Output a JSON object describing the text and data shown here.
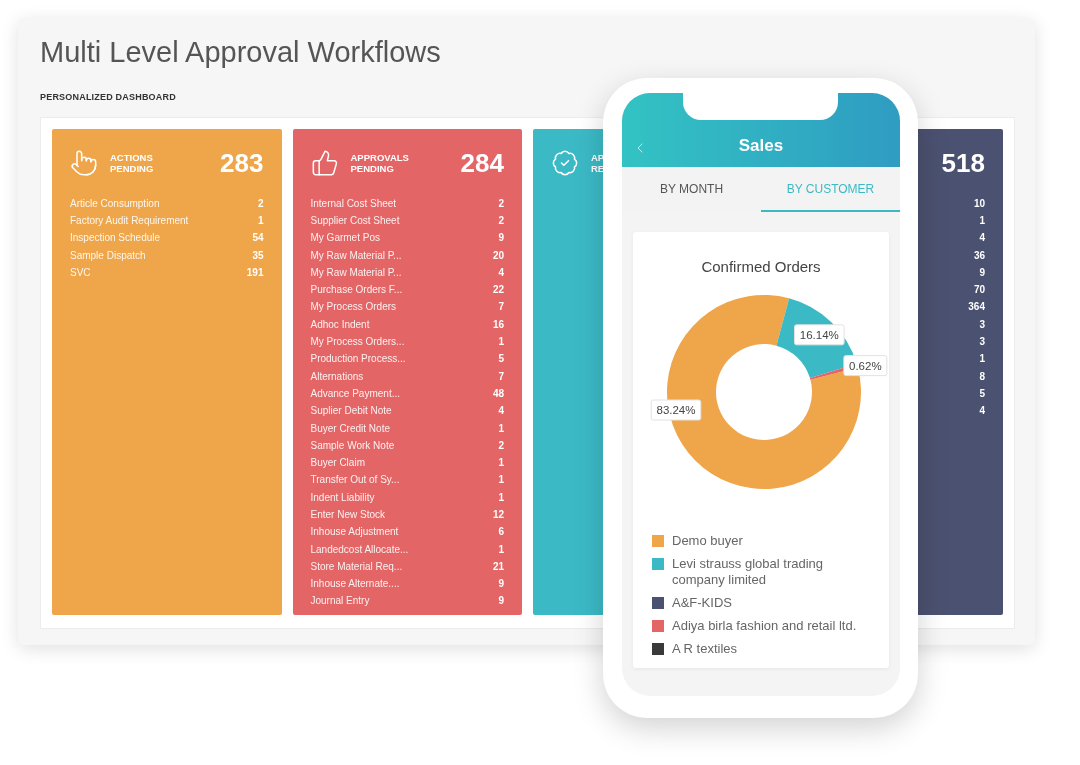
{
  "title": "Multi Level Approval Workflows",
  "subtitle": "PERSONALIZED DASHBOARD",
  "cards": [
    {
      "label_lines": [
        "ACTIONS",
        "PENDING"
      ],
      "count": "283",
      "color": "#efa64a",
      "rows": [
        {
          "label": "Article Consumption",
          "value": "2"
        },
        {
          "label": "Factory Audit Requirement",
          "value": "1"
        },
        {
          "label": "Inspection Schedule",
          "value": "54"
        },
        {
          "label": "Sample Dispatch",
          "value": "35"
        },
        {
          "label": "SVC",
          "value": "191"
        }
      ]
    },
    {
      "label_lines": [
        "APPROVALS",
        "PENDING"
      ],
      "count": "284",
      "color": "#e46566",
      "rows": [
        {
          "label": "Internal Cost Sheet",
          "value": "2"
        },
        {
          "label": "Supplier Cost Sheet",
          "value": "2"
        },
        {
          "label": "My Garmet Pos",
          "value": "9"
        },
        {
          "label": "My Raw Material P...",
          "value": "20"
        },
        {
          "label": "My Raw Material P...",
          "value": "4"
        },
        {
          "label": "Purchase Orders F...",
          "value": "22"
        },
        {
          "label": "My Process Orders",
          "value": "7"
        },
        {
          "label": "Adhoc Indent",
          "value": "16"
        },
        {
          "label": "My Process Orders...",
          "value": "1"
        },
        {
          "label": "Production Process...",
          "value": "5"
        },
        {
          "label": "Alternations",
          "value": "7"
        },
        {
          "label": "Advance Payment...",
          "value": "48"
        },
        {
          "label": "Suplier Debit Note",
          "value": "4"
        },
        {
          "label": "Buyer Credit Note",
          "value": "1"
        },
        {
          "label": "Sample Work Note",
          "value": "2"
        },
        {
          "label": "Buyer Claim",
          "value": "1"
        },
        {
          "label": "Transfer Out of Sy...",
          "value": "1"
        },
        {
          "label": "Indent Liability",
          "value": "1"
        },
        {
          "label": "Enter New Stock",
          "value": "12"
        },
        {
          "label": "Inhouse Adjustment",
          "value": "6"
        },
        {
          "label": "Landedcost Allocate...",
          "value": "1"
        },
        {
          "label": "Store Material Req...",
          "value": "21"
        },
        {
          "label": "Inhouse Alternate....",
          "value": "9"
        },
        {
          "label": "Journal Entry",
          "value": "9"
        }
      ]
    },
    {
      "label_lines": [
        "AP",
        "RE"
      ],
      "color": "#3bbac6"
    },
    {
      "count": "518",
      "color": "#4b5170",
      "rows": [
        {
          "value": "10"
        },
        {
          "value": "1"
        },
        {
          "value": "4"
        },
        {
          "value": "36"
        },
        {
          "value": "9"
        },
        {
          "value": "70"
        },
        {
          "value": "364"
        },
        {
          "value": "3"
        },
        {
          "value": "3"
        },
        {
          "value": "1"
        },
        {
          "value": "8"
        },
        {
          "value": "5"
        },
        {
          "value": "4"
        }
      ]
    }
  ],
  "phone": {
    "header_title": "Sales",
    "tabs": [
      {
        "label": "BY MONTH",
        "selected": false
      },
      {
        "label": "BY CUSTOMER",
        "selected": true
      }
    ],
    "chart_data": {
      "type": "donut",
      "title": "Confirmed Orders",
      "categories": [
        "Demo buyer",
        "Levi strauss global trading company limited",
        "A&F-KIDS",
        "Adiya birla fashion and retail ltd.",
        "A R textiles"
      ],
      "values": [
        83.24,
        16.14,
        0,
        0.62,
        0
      ],
      "value_labels": [
        "83.24%",
        "16.14%",
        null,
        "0.62%",
        null
      ],
      "colors": [
        "#efa64a",
        "#3bbac6",
        "#4b5170",
        "#e46566",
        "#3a3a3a"
      ]
    }
  }
}
